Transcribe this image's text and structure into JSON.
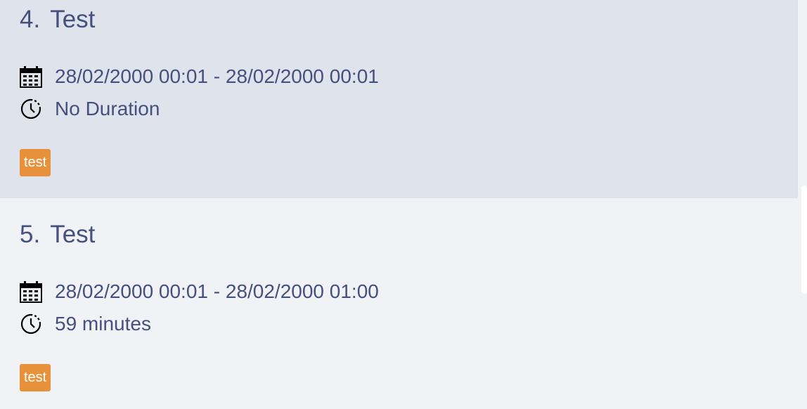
{
  "tasks": [
    {
      "index": "4.",
      "name": "Test",
      "datetime": "28/02/2000 00:01 - 28/02/2000 00:01",
      "duration": "No Duration",
      "tag": "test",
      "selected": true
    },
    {
      "index": "5.",
      "name": "Test",
      "datetime": "28/02/2000 00:01 - 28/02/2000 01:00",
      "duration": "59 minutes",
      "tag": "test",
      "selected": false
    }
  ],
  "icons": {
    "date": "calendar-icon",
    "duration": "clock-icon"
  },
  "colors": {
    "selected_bg": "#dfe3eb",
    "normal_bg": "#f0f2f6",
    "text": "#46507f",
    "tag": "#e8913b"
  }
}
